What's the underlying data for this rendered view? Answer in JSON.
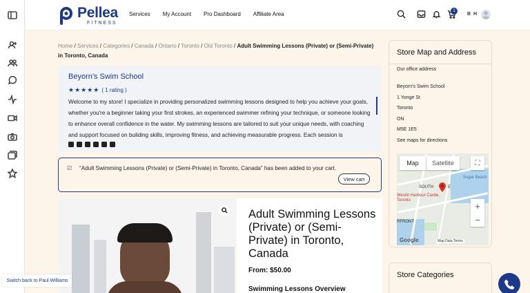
{
  "brand": {
    "name": "Pellea",
    "tagline": "FITNESS",
    "color": "#1d3a8a"
  },
  "nav": [
    "Services",
    "My Account",
    "Pro Dashboard",
    "Affiliate Area"
  ],
  "header": {
    "cart_count": "1",
    "user_initials": "B H"
  },
  "breadcrumb": {
    "links": [
      "Home",
      "Services",
      "Categories",
      "Canada",
      "Ontario",
      "Toronto",
      "Old Toronto"
    ],
    "current": "Adult Swimming Lessons (Private) or (Semi-Private) in Toronto, Canada"
  },
  "store": {
    "name": "Beyorn's Swim School",
    "stars": "★★★★★",
    "rating_text": "( 1 rating )",
    "bio": "Welcome to my store! I specialize in providing personalized swimming lessons designed to help you achieve your goals, whether you're a beginner taking your first strokes, an experienced swimmer refining your technique, or someone looking to enhance overall confidence in the water. My swimming lessons are tailored to suit your unique needs, with coaching and support focused on building skills, improving fitness, and achieving measurable progress. Each session is thoughtfully structured to ensure a safe, supportive, and results-driven experience. Conveniently"
  },
  "notice": {
    "text": "“Adult Swimming Lessons (Private) or (Semi-Private) in Toronto, Canada” has been added to your cart.",
    "button": "View cart"
  },
  "product": {
    "title": "Adult Swimming Lessons (Private) or (Semi-Private) in Toronto, Canada",
    "price": "From: $50.00",
    "section": "Swimming Lessons Overview"
  },
  "sidebar": {
    "title": "Store Map and Address",
    "office_label": "Our office address",
    "address": [
      "Beyorn's Swim School",
      "1 Yonge St",
      "Toronto",
      "ON",
      "M5E 1E5"
    ],
    "maps_link": "See maps for directions",
    "map": {
      "tab_map": "Map",
      "tab_satellite": "Satellite",
      "labels": [
        "Sugar Beach",
        "SOUTH",
        "E",
        "Westin Harbour Castle, Toronto",
        "RFRONT"
      ],
      "google": "Google",
      "footer": "Map Data   Terms"
    },
    "categories_title": "Store Categories"
  },
  "switch_back": "Switch back to Paul Williams"
}
